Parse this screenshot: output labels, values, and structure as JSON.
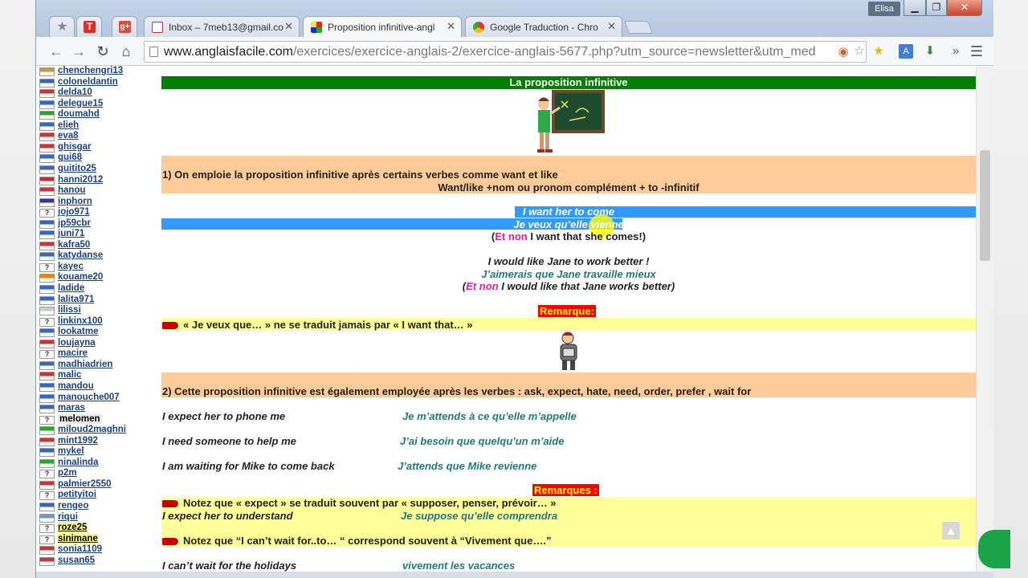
{
  "browser": {
    "tabs": [
      {
        "label": "Inbox – 7meb13@gmail.co"
      },
      {
        "label": "Proposition infinitive-angl"
      },
      {
        "label": "Google Traduction - Chro"
      }
    ],
    "pinned": [
      {
        "icon": "star-icon",
        "glyph": "★"
      },
      {
        "icon": "t-app-icon",
        "glyph": "T"
      },
      {
        "icon": "google-plus-icon",
        "glyph": "g+"
      }
    ],
    "user_badge": "Elisa",
    "url_domain": "www.anglaisfacile.com",
    "url_path": "/exercices/exercice-anglais-2/exercice-anglais-5677.php?utm_source=newsletter&utm_med",
    "colors": {
      "accent": "#3399ff",
      "title_green": "#008000",
      "orange_band": "#ffcc99",
      "yellow_band": "#ffff99",
      "remark_red": "#ff0000"
    }
  },
  "sidebar": {
    "members": [
      {
        "name": "chenchengri13",
        "flag": "#c93",
        "q": false
      },
      {
        "name": "coloneldantin",
        "flag": "#36c",
        "q": false
      },
      {
        "name": "delda10",
        "flag": "#c33",
        "q": false
      },
      {
        "name": "delegue15",
        "flag": "#36c",
        "q": false
      },
      {
        "name": "doumahd",
        "flag": "#2a2",
        "q": false
      },
      {
        "name": "elieh",
        "flag": "#36c",
        "q": false
      },
      {
        "name": "eva8",
        "flag": "#c33",
        "q": false
      },
      {
        "name": "ghisgar",
        "flag": "#c33",
        "q": false
      },
      {
        "name": "gui68",
        "flag": "#36c",
        "q": false
      },
      {
        "name": "guitito25",
        "flag": "#36c",
        "q": false
      },
      {
        "name": "hanni2012",
        "flag": "#d22",
        "q": false
      },
      {
        "name": "hanou",
        "flag": "#c33",
        "q": false
      },
      {
        "name": "inphorn",
        "flag": "#33a",
        "q": false
      },
      {
        "name": "jojo971",
        "flag": "",
        "q": true
      },
      {
        "name": "jp59cbr",
        "flag": "#36c",
        "q": false
      },
      {
        "name": "juni71",
        "flag": "#36c",
        "q": false
      },
      {
        "name": "kafra50",
        "flag": "#c33",
        "q": false
      },
      {
        "name": "katydanse",
        "flag": "#36c",
        "q": false
      },
      {
        "name": "kayec",
        "flag": "",
        "q": true
      },
      {
        "name": "kouame20",
        "flag": "#e80",
        "q": false
      },
      {
        "name": "ladide",
        "flag": "#36c",
        "q": false
      },
      {
        "name": "lalita971",
        "flag": "#36c",
        "q": false
      },
      {
        "name": "lilissi",
        "flag": "#ccc",
        "q": false
      },
      {
        "name": "linkinx100",
        "flag": "",
        "q": true
      },
      {
        "name": "lookatme",
        "flag": "#36c",
        "q": false
      },
      {
        "name": "loujayna",
        "flag": "#c33",
        "q": false
      },
      {
        "name": "macire",
        "flag": "",
        "q": true
      },
      {
        "name": "madhiadrien",
        "flag": "#36c",
        "q": false
      },
      {
        "name": "malic",
        "flag": "#c33",
        "q": false
      },
      {
        "name": "mandou",
        "flag": "#36c",
        "q": false
      },
      {
        "name": "manouche007",
        "flag": "#36c",
        "q": false
      },
      {
        "name": "maras",
        "flag": "#36c",
        "q": false
      },
      {
        "name": "melomen",
        "flag": "",
        "q": true
      },
      {
        "name": "miloud2maghni",
        "flag": "#2a2",
        "q": false
      },
      {
        "name": "mint1992",
        "flag": "#c33",
        "q": false
      },
      {
        "name": "mykel",
        "flag": "#36c",
        "q": false
      },
      {
        "name": "ninalinda",
        "flag": "#2a2",
        "q": false
      },
      {
        "name": "p2m",
        "flag": "",
        "q": true
      },
      {
        "name": "palmier2550",
        "flag": "#c33",
        "q": false
      },
      {
        "name": "petityitoi",
        "flag": "",
        "q": true
      },
      {
        "name": "rengeo",
        "flag": "#36c",
        "q": false
      },
      {
        "name": "riqui",
        "flag": "#69c",
        "q": false
      },
      {
        "name": "roze25",
        "flag": "",
        "q": true
      },
      {
        "name": "sinimane",
        "flag": "",
        "q": true
      },
      {
        "name": "sonia1109",
        "flag": "#c33",
        "q": false
      },
      {
        "name": "susan65",
        "flag": "#c33",
        "q": false
      }
    ]
  },
  "lesson": {
    "title": "La proposition infinitive",
    "rule1_title": "1) On emploie la proposition infinitive après certains verbes comme want et like",
    "rule1_formula": "Want/like +nom ou pronom complément + to -infinitif",
    "ex1_en": "I want her to come",
    "ex1_fr": "Je veux qu’elle vienne",
    "ex1_not_open": "(",
    "ex1_not_word": "Et non",
    "ex1_not_rest": " I want that she comes!)",
    "ex2_en": "I would like Jane to work better !",
    "ex2_fr": "J’aimerais que Jane travaille mieux",
    "ex2_not_open": "(",
    "ex2_not_word": "Et non",
    "ex2_not_rest": " I would like that Jane works better)",
    "remark_label": "Remarque:",
    "remark_text": "« Je veux que… »  ne se traduit jamais par  « I want that… »",
    "rule2_title": "2) Cette proposition infinitive est également employée après les verbes : ask, expect, hate, need, order, prefer , wait for",
    "pairs": [
      {
        "en": "I expect her to phone me",
        "fr": "Je m’attends à ce qu’elle m’appelle"
      },
      {
        "en": "I need someone to help me",
        "fr": "J’ai besoin que quelqu’un m’aide"
      },
      {
        "en": "I am waiting for Mike to come back",
        "fr": "J’attends que Mike revienne"
      }
    ],
    "remarks_label": "Remarques :",
    "note1": "Notez que « expect » se traduit souvent par « supposer, penser, prévoir… »",
    "note1_en": "I expect her to understand",
    "note1_fr": "Je suppose qu’elle comprendra",
    "note2": "Notez que “I can’t wait for..to…  “ correspond souvent à “Vivement que….”",
    "note2_en": "I can’t wait for the holidays",
    "note2_fr": "vivement les vacances"
  }
}
